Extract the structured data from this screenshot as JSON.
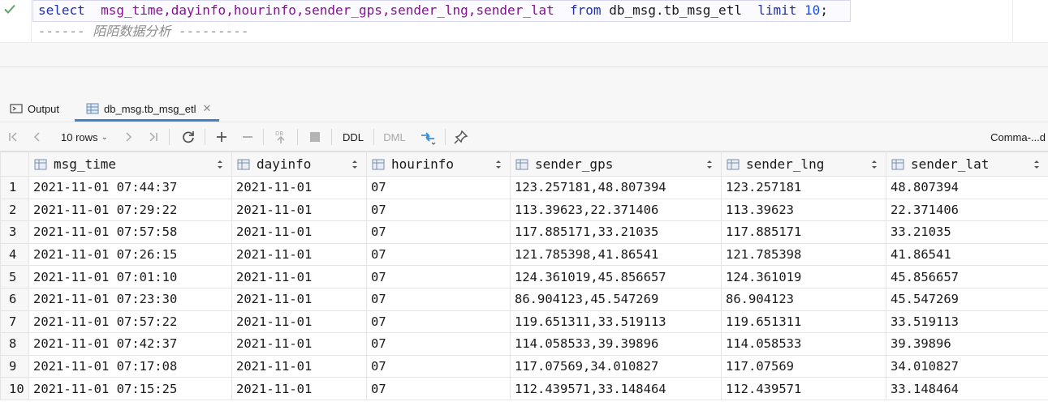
{
  "editor": {
    "line1": {
      "kw_select": "select",
      "columns_text": "  msg_time,dayinfo,hourinfo,sender_gps,sender_lng,sender_lat",
      "kw_from": "from",
      "table_name": " db_msg.tb_msg_etl ",
      "kw_limit": "limit",
      "limit_value": "10",
      "terminator": ";"
    },
    "line2": "------ 陌陌数据分析 ---------"
  },
  "tabs": {
    "output": "Output",
    "table": "db_msg.tb_msg_etl"
  },
  "toolbar": {
    "rows": "10 rows",
    "ddl": "DDL",
    "dml": "DML",
    "comma": "Comma-...d"
  },
  "columns": [
    "msg_time",
    "dayinfo",
    "hourinfo",
    "sender_gps",
    "sender_lng",
    "sender_lat"
  ],
  "rows": [
    [
      "1",
      "2021-11-01 07:44:37",
      "2021-11-01",
      "07",
      "123.257181,48.807394",
      "123.257181",
      "48.807394"
    ],
    [
      "2",
      "2021-11-01 07:29:22",
      "2021-11-01",
      "07",
      "113.39623,22.371406",
      "113.39623",
      "22.371406"
    ],
    [
      "3",
      "2021-11-01 07:57:58",
      "2021-11-01",
      "07",
      "117.885171,33.21035",
      "117.885171",
      "33.21035"
    ],
    [
      "4",
      "2021-11-01 07:26:15",
      "2021-11-01",
      "07",
      "121.785398,41.86541",
      "121.785398",
      "41.86541"
    ],
    [
      "5",
      "2021-11-01 07:01:10",
      "2021-11-01",
      "07",
      "124.361019,45.856657",
      "124.361019",
      "45.856657"
    ],
    [
      "6",
      "2021-11-01 07:23:30",
      "2021-11-01",
      "07",
      "86.904123,45.547269",
      "86.904123",
      "45.547269"
    ],
    [
      "7",
      "2021-11-01 07:57:22",
      "2021-11-01",
      "07",
      "119.651311,33.519113",
      "119.651311",
      "33.519113"
    ],
    [
      "8",
      "2021-11-01 07:42:37",
      "2021-11-01",
      "07",
      "114.058533,39.39896",
      "114.058533",
      "39.39896"
    ],
    [
      "9",
      "2021-11-01 07:17:08",
      "2021-11-01",
      "07",
      "117.07569,34.010827",
      "117.07569",
      "34.010827"
    ],
    [
      "10",
      "2021-11-01 07:15:25",
      "2021-11-01",
      "07",
      "112.439571,33.148464",
      "112.439571",
      "33.148464"
    ]
  ]
}
